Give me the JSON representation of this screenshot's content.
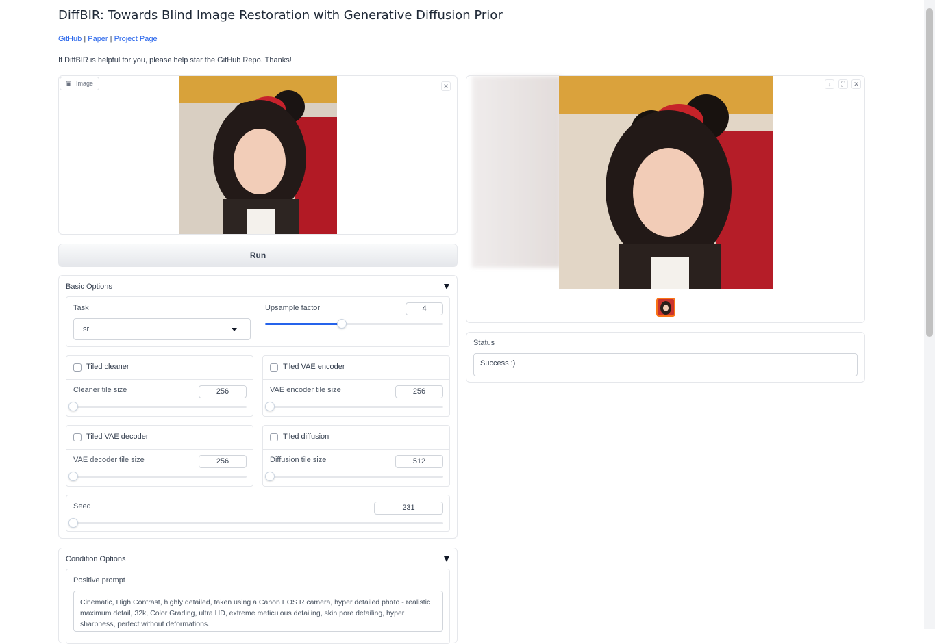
{
  "header": {
    "title": "DiffBIR: Towards Blind Image Restoration with Generative Diffusion Prior",
    "links": [
      "GitHub",
      "Paper",
      "Project Page"
    ],
    "link_sep": "|",
    "helper_text": "If DiffBIR is helpful for you, please help star the GitHub Repo. Thanks!"
  },
  "input_image": {
    "badge_label": "Image",
    "clear_icon": "close-icon"
  },
  "run_button": {
    "label": "Run"
  },
  "basic_options": {
    "title": "Basic Options",
    "task": {
      "label": "Task",
      "value": "sr"
    },
    "upsample": {
      "label": "Upsample factor",
      "value": "4",
      "fraction": 0.43
    },
    "tiled_cleaner": {
      "label": "Tiled cleaner",
      "checked": false
    },
    "cleaner_tile": {
      "label": "Cleaner tile size",
      "value": "256",
      "fraction": 0
    },
    "tiled_vae_encoder": {
      "label": "Tiled VAE encoder",
      "checked": false
    },
    "vae_encoder_tile": {
      "label": "VAE encoder tile size",
      "value": "256",
      "fraction": 0
    },
    "tiled_vae_decoder": {
      "label": "Tiled VAE decoder",
      "checked": false
    },
    "vae_decoder_tile": {
      "label": "VAE decoder tile size",
      "value": "256",
      "fraction": 0
    },
    "tiled_diffusion": {
      "label": "Tiled diffusion",
      "checked": false
    },
    "diffusion_tile": {
      "label": "Diffusion tile size",
      "value": "512",
      "fraction": 0
    },
    "seed": {
      "label": "Seed",
      "value": "231",
      "fraction": 0
    }
  },
  "condition_options": {
    "title": "Condition Options",
    "positive_prompt": {
      "label": "Positive prompt",
      "value": "Cinematic, High Contrast, highly detailed, taken using a Canon EOS R camera, hyper detailed photo - realistic maximum detail, 32k, Color Grading, ultra HD, extreme meticulous detailing, skin pore detailing, hyper sharpness, perfect without deformations."
    }
  },
  "output": {
    "icons": [
      "download-icon",
      "fullscreen-icon",
      "close-icon"
    ]
  },
  "status": {
    "label": "Status",
    "value": "Success :)"
  },
  "colors": {
    "accent": "#2563eb",
    "link": "#2563eb",
    "border": "#e5e7eb"
  }
}
